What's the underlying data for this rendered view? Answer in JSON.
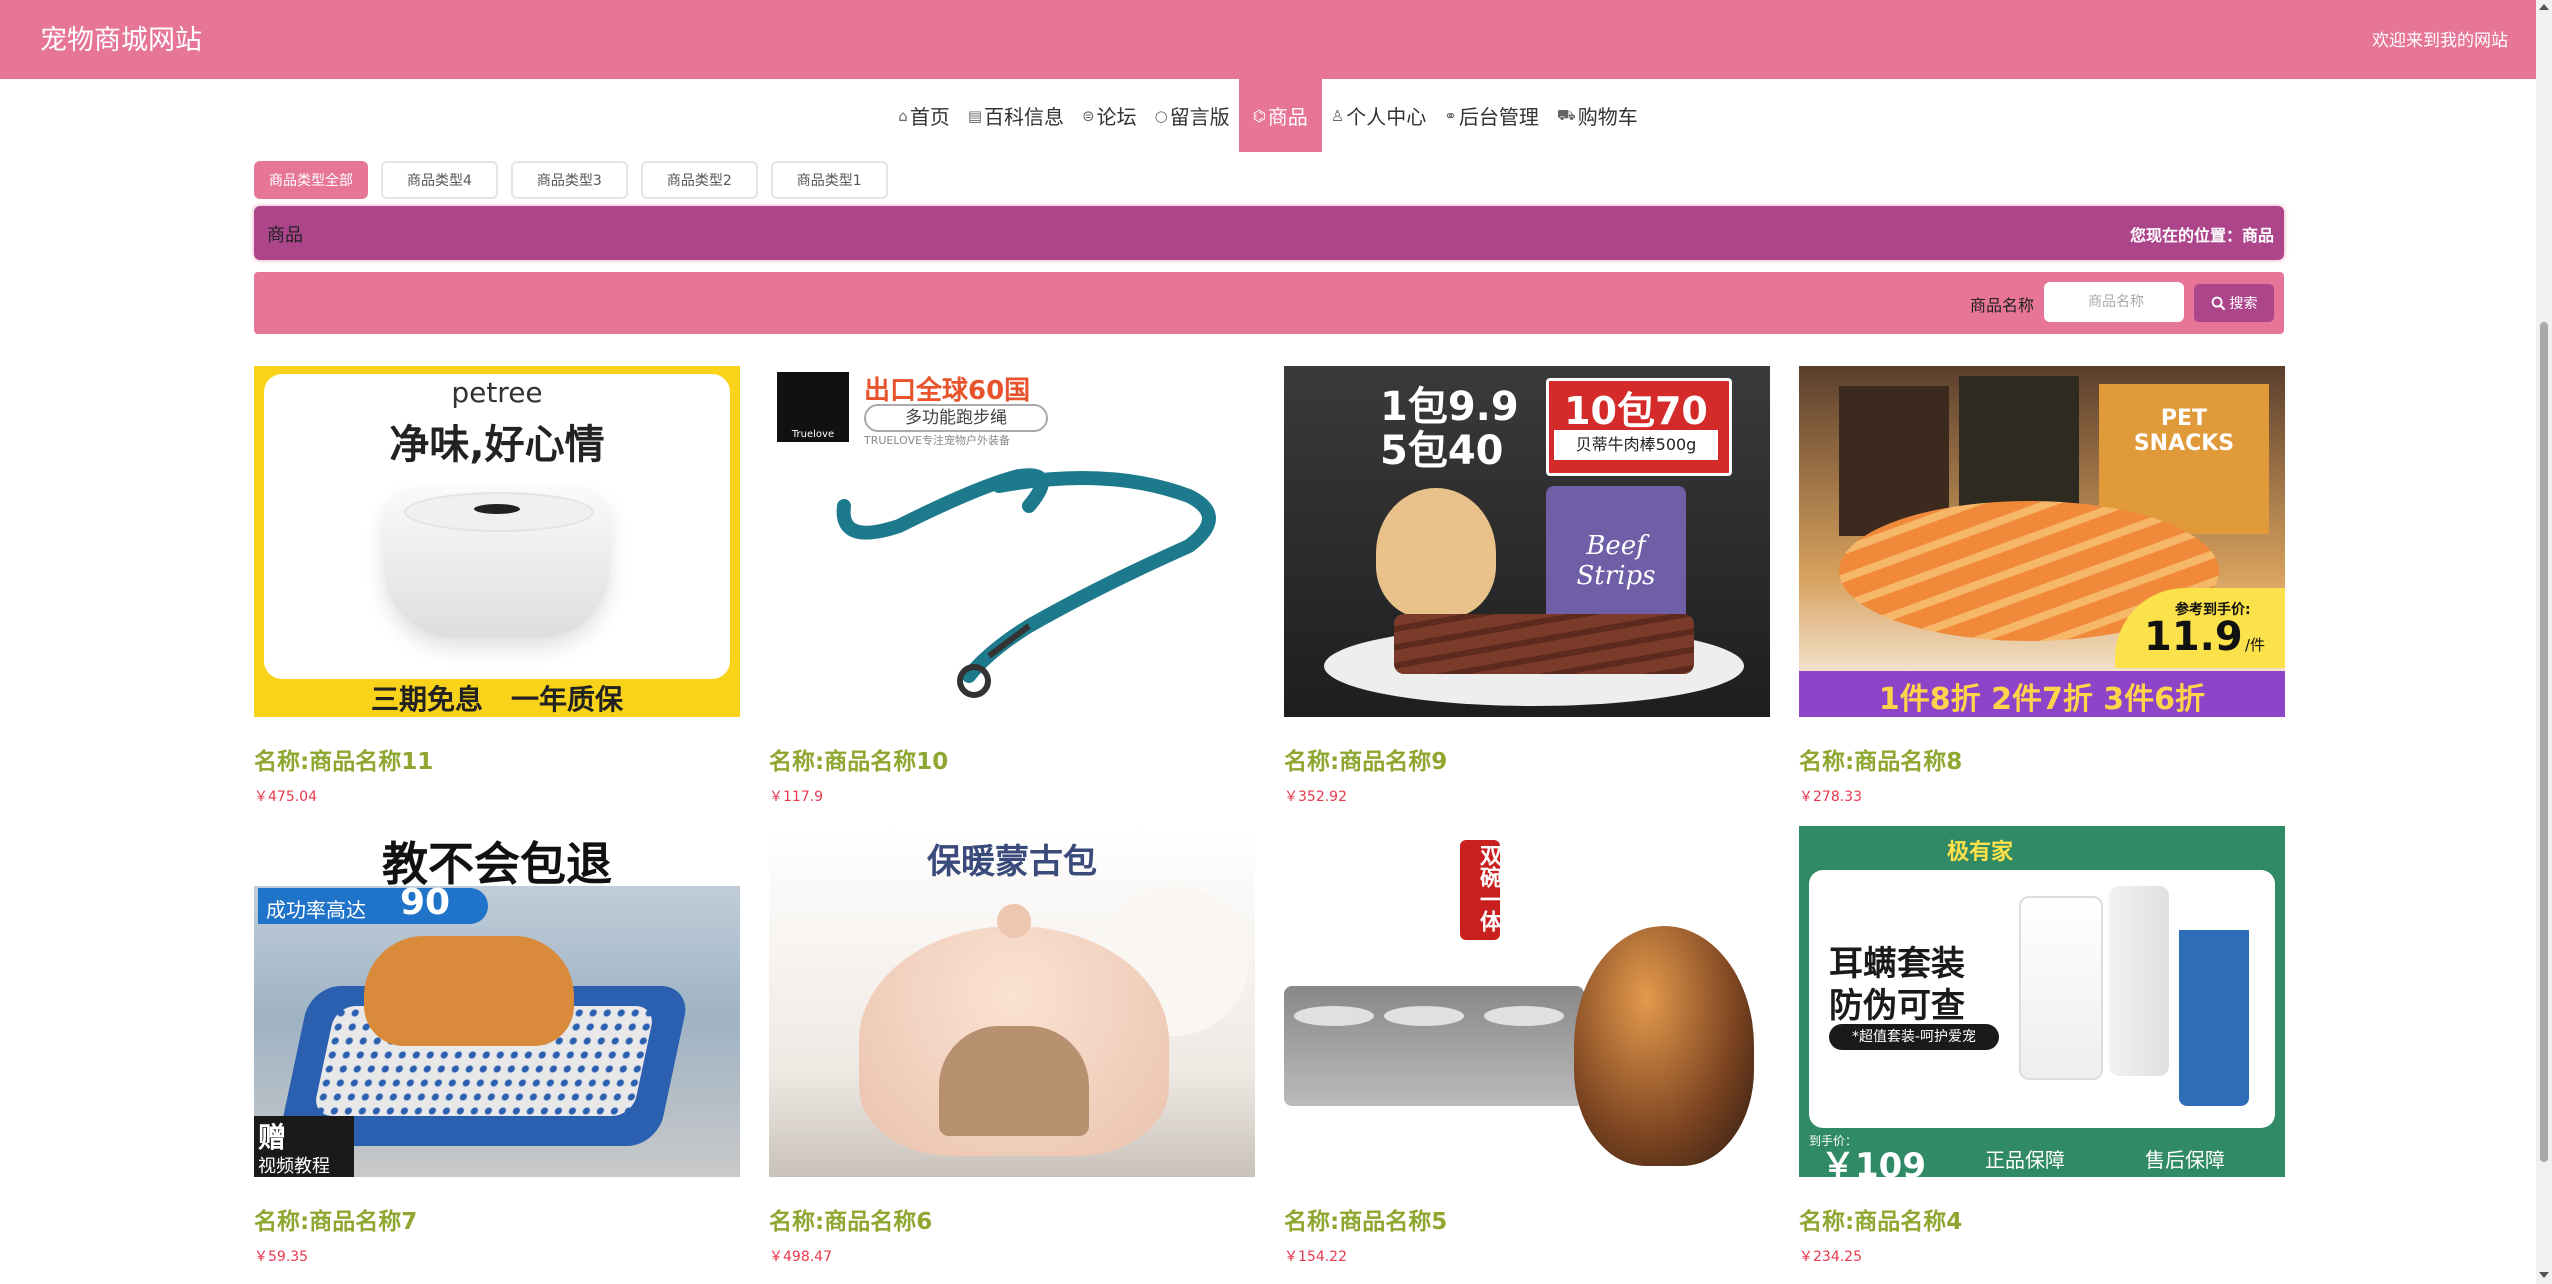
{
  "header": {
    "site_title": "宠物商城网站",
    "welcome_text": "欢迎来到我的网站"
  },
  "nav": [
    {
      "icon": "home-icon",
      "label": "首页",
      "active": false
    },
    {
      "icon": "document-icon",
      "label": "百科信息",
      "active": false
    },
    {
      "icon": "forum-icon",
      "label": "论坛",
      "active": false
    },
    {
      "icon": "message-icon",
      "label": "留言版",
      "active": false
    },
    {
      "icon": "goods-icon",
      "label": "商品",
      "active": true
    },
    {
      "icon": "user-icon",
      "label": "个人中心",
      "active": false
    },
    {
      "icon": "link-icon",
      "label": "后台管理",
      "active": false
    },
    {
      "icon": "cart-icon",
      "label": "购物车",
      "active": false
    }
  ],
  "category_tabs": [
    {
      "label": "商品类型全部",
      "active": true
    },
    {
      "label": "商品类型4",
      "active": false
    },
    {
      "label": "商品类型3",
      "active": false
    },
    {
      "label": "商品类型2",
      "active": false
    },
    {
      "label": "商品类型1",
      "active": false
    }
  ],
  "breadcrumb": {
    "title": "商品",
    "location": "您现在的位置：商品"
  },
  "search": {
    "label": "商品名称",
    "placeholder": "商品名称",
    "value": "",
    "button_label": "搜索"
  },
  "products": [
    {
      "name": "名称:商品名称11",
      "price": "￥475.04",
      "image_text": {
        "brand": "petree",
        "headline": "净味,好心情",
        "footer": "三期免息　一年质保"
      }
    },
    {
      "name": "名称:商品名称10",
      "price": "￥117.9",
      "image_text": {
        "headline": "出口全球60国",
        "sub": "多功能跑步绳",
        "note": "TRUELOVE专注宠物户外装备",
        "logo": "Truelove"
      }
    },
    {
      "name": "名称:商品名称9",
      "price": "￥352.92",
      "image_text": {
        "line1": "1包9.9",
        "line2": "5包40",
        "badge": "10包70",
        "badge_sub": "贝蒂牛肉棒500g",
        "pack": "Beef Strips"
      }
    },
    {
      "name": "名称:商品名称8",
      "price": "￥278.33",
      "image_text": {
        "ref_label": "参考到手价:",
        "price": "11.9",
        "unit": "/件",
        "footer": "1件8折 2件7折 3件6折",
        "pack": "PET SNACKS"
      }
    },
    {
      "name": "名称:商品名称7",
      "price": "￥59.35",
      "image_text": {
        "headline": "教不会包退",
        "sub": "成功率高达",
        "percent": "90",
        "gift": "赠",
        "gift_sub": "视频教程"
      }
    },
    {
      "name": "名称:商品名称6",
      "price": "￥498.47",
      "image_text": {
        "headline": "保暖蒙古包"
      }
    },
    {
      "name": "名称:商品名称5",
      "price": "￥154.22",
      "image_text": {
        "seal": "双碗一体"
      }
    },
    {
      "name": "名称:商品名称4",
      "price": "￥234.25",
      "image_text": {
        "brand": "极有家",
        "headline1": "耳螨套装",
        "headline2": "防伪可查",
        "sub": "*超值套装-呵护爱宠",
        "price_label": "到手价：",
        "price": "￥109",
        "badge1": "正品保障",
        "badge2": "售后保障"
      }
    }
  ],
  "colors": {
    "primary": "#e67597",
    "secondary": "#ad458b",
    "name_color": "#8fa731",
    "price_color": "#e8384d"
  }
}
